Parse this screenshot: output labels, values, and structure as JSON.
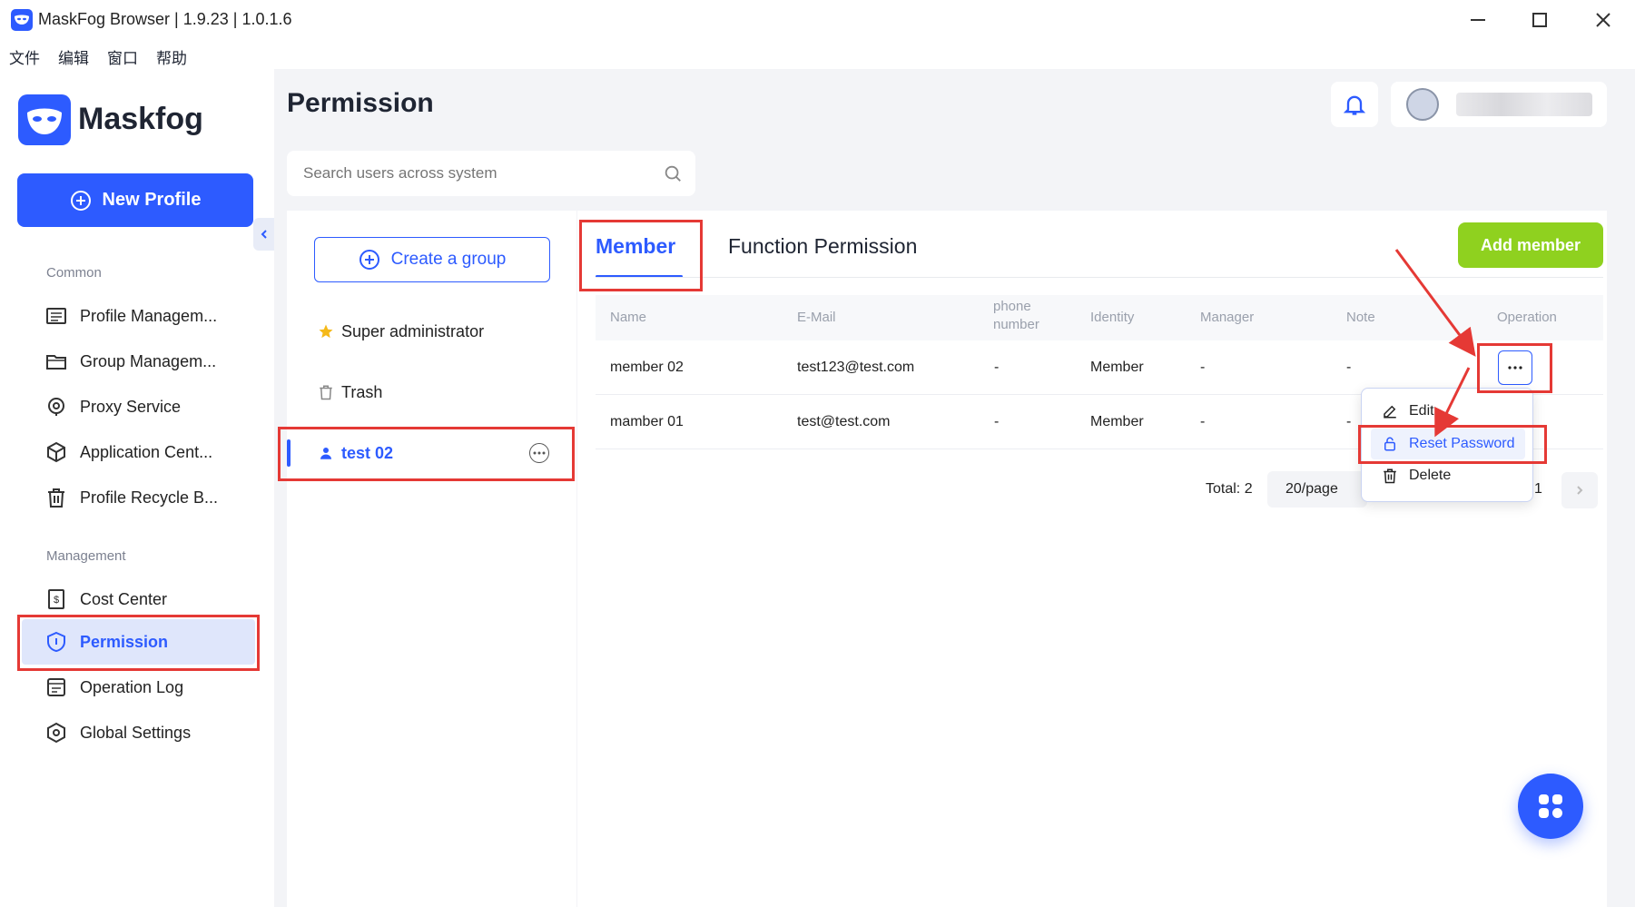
{
  "window": {
    "title": "MaskFog Browser | 1.9.23 | 1.0.1.6"
  },
  "menubar": [
    "文件",
    "编辑",
    "窗口",
    "帮助"
  ],
  "brand": {
    "name": "Maskfog"
  },
  "sidebar": {
    "new_profile": "New Profile",
    "common_label": "Common",
    "common_items": [
      {
        "label": "Profile Managem...",
        "icon": "profile-icon"
      },
      {
        "label": "Group Managem...",
        "icon": "folder-icon"
      },
      {
        "label": "Proxy Service",
        "icon": "location-icon"
      },
      {
        "label": "Application Cent...",
        "icon": "cube-icon"
      },
      {
        "label": "Profile Recycle B...",
        "icon": "trash-icon"
      }
    ],
    "management_label": "Management",
    "management_items": [
      {
        "label": "Cost Center",
        "icon": "receipt-icon"
      },
      {
        "label": "Permission",
        "icon": "shield-icon",
        "active": true
      },
      {
        "label": "Operation Log",
        "icon": "log-icon"
      },
      {
        "label": "Global Settings",
        "icon": "hexagon-settings-icon"
      }
    ]
  },
  "page": {
    "title": "Permission",
    "search_placeholder": "Search users across system"
  },
  "groups": {
    "create_label": "Create a group",
    "items": [
      {
        "label": "Super administrator",
        "icon": "star-icon"
      },
      {
        "label": "Trash",
        "icon": "trash-icon"
      },
      {
        "label": "test 02",
        "icon": "user-icon",
        "active": true
      }
    ]
  },
  "tabs": [
    {
      "label": "Member",
      "active": true
    },
    {
      "label": "Function Permission",
      "active": false
    }
  ],
  "add_member": "Add member",
  "table": {
    "headers": {
      "name": "Name",
      "email": "E-Mail",
      "phone": "phone number",
      "identity": "Identity",
      "manager": "Manager",
      "note": "Note",
      "operation": "Operation"
    },
    "rows": [
      {
        "name": "member 02",
        "email": "test123@test.com",
        "phone": "-",
        "identity": "Member",
        "manager": "-",
        "note": "-"
      },
      {
        "name": "mamber 01",
        "email": "test@test.com",
        "phone": "-",
        "identity": "Member",
        "manager": "-",
        "note": "-"
      }
    ]
  },
  "pagination": {
    "total": "Total: 2",
    "page_size": "20/page",
    "page": "1"
  },
  "dropdown": {
    "edit": "Edit",
    "reset": "Reset Password",
    "delete": "Delete"
  },
  "colors": {
    "accent": "#2d5bff",
    "add_member": "#8fd11f",
    "annotation": "#e53935"
  }
}
